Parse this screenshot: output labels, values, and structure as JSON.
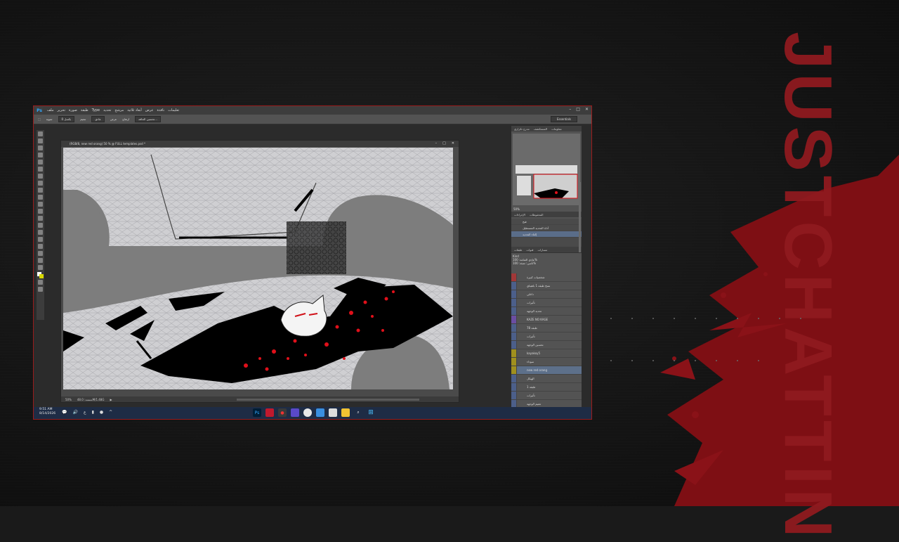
{
  "brand": {
    "text": "JUSTCHATTIN"
  },
  "photoshop": {
    "logo": "Ps",
    "menu": [
      "ملف",
      "تحرير",
      "صورة",
      "طبقة",
      "Type",
      "تحديد",
      "مرشح",
      "أبعاد ثلاثية",
      "عرض",
      "نافذة",
      "تعليمات"
    ],
    "options": {
      "feather": "تمويه",
      "value": "0 بكسل",
      "antialias": "تنعيم",
      "style": "عادي",
      "width": "عرض",
      "height": "ارتفاع",
      "refine": "تحسين الحافة..."
    },
    "workspace": "Essentials",
    "document_title": "(RGB/8, new red orang) 50 % @ FULL templates.psd *",
    "status": {
      "zoom": "50%",
      "doc": "مستند: 48.0M/1.48G"
    },
    "navigator": {
      "tabs": [
        "مدرج تكراري",
        "المستكشف",
        "معلومات"
      ],
      "zoom": "50%"
    },
    "history": {
      "tabs": [
        "الإجراءات",
        "المحفوظات"
      ],
      "items": [
        "فتح",
        "أداة التحديد المستطيل",
        "إلغاء التحديد"
      ]
    },
    "layers": {
      "tabs": [
        "طبقات",
        "قنوات",
        "مسارات"
      ],
      "kind": "Kind",
      "blend": "عادي",
      "opacity_label": "العتامة:",
      "opacity": "100%",
      "fill_label": "تعبئة:",
      "fill": "100%",
      "lock_label": "تأمين:",
      "rows": [
        {
          "name": "شخصيات كبيرة",
          "color": "#a13838"
        },
        {
          "name": "نسخ طبقة 1 باهيتاي",
          "color": "#4c5f8a"
        },
        {
          "name": "داخلي",
          "color": "#4c5f8a"
        },
        {
          "name": "تأثيرات",
          "color": "#4c5f8a"
        },
        {
          "name": "تحديد الوجهة",
          "color": "#4c5f8a"
        },
        {
          "name": "KAZE NO KAGE",
          "color": "#6b4ea3"
        },
        {
          "name": "طبقة 78",
          "color": "#4c5f8a"
        },
        {
          "name": "تأثيرات",
          "color": "#4c5f8a"
        },
        {
          "name": "تحسين الوجهة",
          "color": "#4c5f8a"
        },
        {
          "name": "kayakoy5",
          "color": "#a0901e"
        },
        {
          "name": "سوداء",
          "color": "#a0901e"
        },
        {
          "name": "new red orang",
          "color": "#a0901e"
        },
        {
          "name": "الهيكل",
          "color": "#4c5f8a"
        },
        {
          "name": "طبقة 1",
          "color": "#4c5f8a"
        },
        {
          "name": "تأثيرات",
          "color": "#4c5f8a"
        },
        {
          "name": "تعتيم الوجهة",
          "color": "#4c5f8a"
        }
      ]
    }
  },
  "taskbar": {
    "time": "9:51 AM",
    "date": "8/14/2026",
    "lang": "ع"
  }
}
